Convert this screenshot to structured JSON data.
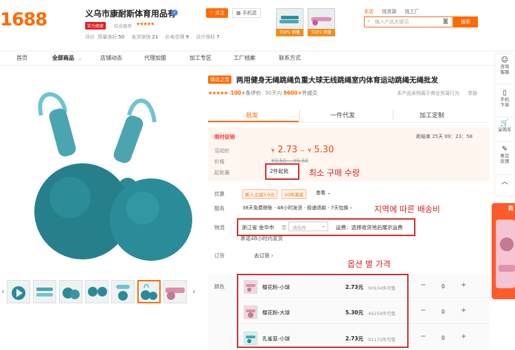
{
  "header": {
    "logo": "1688",
    "shop_name": "义乌市康耐斯体育用品有",
    "follow": "关注",
    "mobile_shop": "手机逛",
    "badge": "实力商家",
    "service": "综合服务",
    "stars": "★★★★★",
    "scores": [
      {
        "k": "评价",
        "v": ""
      },
      {
        "k": "质量很好",
        "v": "50"
      },
      {
        "k": "发货很快",
        "v": "21"
      },
      {
        "k": "价格合理",
        "v": "9"
      },
      {
        "k": "设计很好",
        "v": "7"
      }
    ],
    "top_tags": [
      "TOP1 销量",
      "TOP2 销量"
    ],
    "search_tabs": [
      "本店",
      "找货源",
      "找工厂"
    ],
    "search_placeholder": "输入产品关键词",
    "search_button": "搜索"
  },
  "nav": [
    "首页",
    "全部商品",
    "店铺动态",
    "代理加盟",
    "加工专区",
    "工厂档案",
    "联系方式"
  ],
  "product": {
    "store_tag": "镇店之宝",
    "title": "两用健身无绳跳绳负重大球无线跳绳室内体育运动跳绳无绳批发",
    "stars": "★★★★★",
    "reviews_count": "100+",
    "reviews_label": "条评价",
    "sales": "90天内",
    "sales_count": "9600+",
    "sales_suffix": "件成交",
    "report_note": "本产品采购属于商业贸易行为",
    "report": "举报"
  },
  "tabs": [
    "批发",
    "一件代发",
    "加工定制"
  ],
  "price": {
    "promo": "限时促销",
    "countdown": "距结束 25天 09：23：58",
    "activity_label": "活动价",
    "activity_low": "2.73",
    "activity_high": "5.30",
    "currency": "¥",
    "tilde": "~",
    "price_label": "价格",
    "old_price": "¥3.50 ~ ¥6.50",
    "moq_label": "起批量",
    "moq_value": "2件起批"
  },
  "annotations": {
    "moq": "최소 구매 수량",
    "shipping": "지역에 따른 배송비",
    "options": "옵션 별 가격"
  },
  "offers": {
    "label": "优惠",
    "tags": [
      "新人立减3.0元",
      "20件满减"
    ],
    "view": "查看 ⌄"
  },
  "service": {
    "label": "服务",
    "text": "38天免费赊账 · 48小时发货 · 极速退款 · 7天包换 ›"
  },
  "shipping": {
    "label": "物流",
    "from": "浙江省 金华市",
    "to": "至",
    "placeholder": "请选择",
    "fee": "运费：选择收货地后展示运费",
    "note": "承诺48小时内发货"
  },
  "order": {
    "label": "订货",
    "text": "去订货 ›"
  },
  "options": {
    "label": "颜色",
    "items": [
      {
        "name": "樱花粉-小球",
        "price": "2.73元",
        "stock": "90634件可售",
        "qty": "0"
      },
      {
        "name": "樱花粉-大球",
        "price": "5.30元",
        "stock": "46259件可售",
        "qty": "0"
      },
      {
        "name": "孔雀蓝-小球",
        "price": "2.73元",
        "stock": "91173件可售",
        "qty": "0"
      }
    ],
    "minus": "−",
    "plus": "+"
  },
  "sidebar": [
    {
      "icon": "☺",
      "label": "咨询\n客服"
    },
    {
      "icon": "▯",
      "label": "手机\n下单"
    },
    {
      "icon": "🛒",
      "label": "采购车"
    },
    {
      "icon": "✎",
      "label": "意见\n反馈"
    },
    {
      "icon": "︿",
      "label": ""
    }
  ],
  "side_ad": "商"
}
